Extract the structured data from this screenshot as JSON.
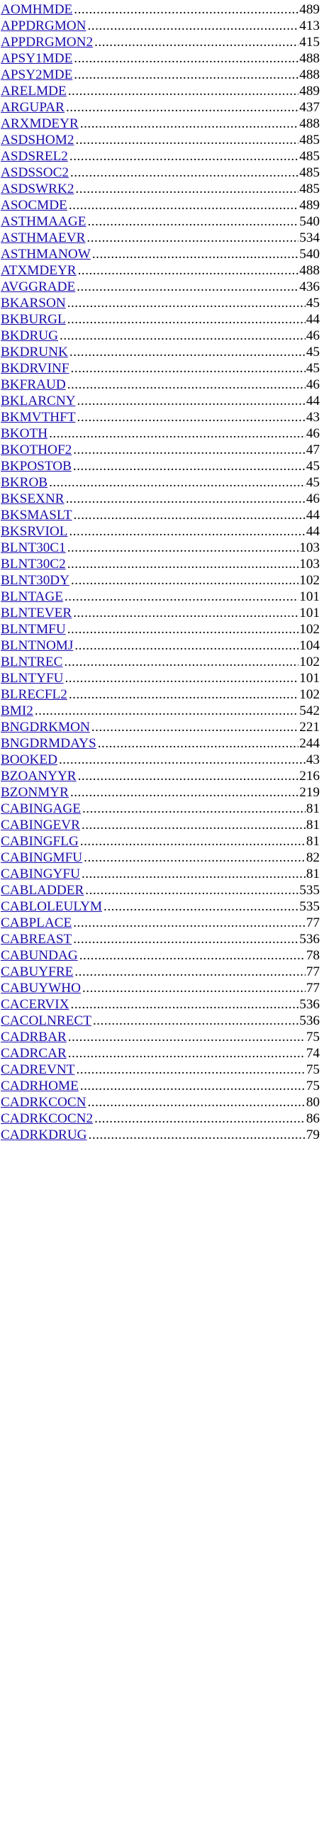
{
  "entries": [
    {
      "term": "AOMHMDE",
      "page": "489"
    },
    {
      "term": "APPDRGMON",
      "page": "413"
    },
    {
      "term": "APPDRGMON2",
      "page": "415"
    },
    {
      "term": "APSY1MDE",
      "page": "488"
    },
    {
      "term": "APSY2MDE",
      "page": "488"
    },
    {
      "term": "ARELMDE",
      "page": "489"
    },
    {
      "term": "ARGUPAR",
      "page": "437"
    },
    {
      "term": "ARXMDEYR",
      "page": "488"
    },
    {
      "term": "ASDSHOM2",
      "page": "485"
    },
    {
      "term": "ASDSREL2",
      "page": "485"
    },
    {
      "term": "ASDSSOC2",
      "page": "485"
    },
    {
      "term": "ASDSWRK2",
      "page": "485"
    },
    {
      "term": "ASOCMDE",
      "page": "489"
    },
    {
      "term": "ASTHMAAGE",
      "page": "540"
    },
    {
      "term": "ASTHMAEVR",
      "page": "534"
    },
    {
      "term": "ASTHMANOW",
      "page": "540"
    },
    {
      "term": "ATXMDEYR",
      "page": "488"
    },
    {
      "term": "AVGGRADE",
      "page": "436"
    },
    {
      "term": "BKARSON",
      "page": "45"
    },
    {
      "term": "BKBURGL",
      "page": "44"
    },
    {
      "term": "BKDRUG",
      "page": "46"
    },
    {
      "term": "BKDRUNK",
      "page": "45"
    },
    {
      "term": "BKDRVINF",
      "page": "45"
    },
    {
      "term": "BKFRAUD",
      "page": "46"
    },
    {
      "term": "BKLARCNY",
      "page": "44"
    },
    {
      "term": "BKMVTHFT",
      "page": "43"
    },
    {
      "term": "BKOTH",
      "page": "46"
    },
    {
      "term": "BKOTHOF2",
      "page": "47"
    },
    {
      "term": "BKPOSTOB",
      "page": "45"
    },
    {
      "term": "BKROB",
      "page": "45"
    },
    {
      "term": "BKSEXNR",
      "page": "46"
    },
    {
      "term": "BKSMASLT",
      "page": "44"
    },
    {
      "term": "BKSRVIOL",
      "page": "44"
    },
    {
      "term": "BLNT30C1",
      "page": "103"
    },
    {
      "term": "BLNT30C2",
      "page": "103"
    },
    {
      "term": "BLNT30DY",
      "page": "102"
    },
    {
      "term": "BLNTAGE",
      "page": "101"
    },
    {
      "term": "BLNTEVER",
      "page": "101"
    },
    {
      "term": "BLNTMFU",
      "page": "102"
    },
    {
      "term": "BLNTNOMJ",
      "page": "104"
    },
    {
      "term": "BLNTREC",
      "page": "102"
    },
    {
      "term": "BLNTYFU",
      "page": "101"
    },
    {
      "term": "BLRECFL2",
      "page": "102"
    },
    {
      "term": "BMI2",
      "page": "542"
    },
    {
      "term": "BNGDRKMON",
      "page": "221"
    },
    {
      "term": "BNGDRMDAYS",
      "page": "244"
    },
    {
      "term": "BOOKED",
      "page": "43"
    },
    {
      "term": "BZOANYYR",
      "page": "216"
    },
    {
      "term": "BZONMYR",
      "page": "219"
    },
    {
      "term": "CABINGAGE",
      "page": "81"
    },
    {
      "term": "CABINGEVR",
      "page": "81"
    },
    {
      "term": "CABINGFLG",
      "page": "81"
    },
    {
      "term": "CABINGMFU",
      "page": "82"
    },
    {
      "term": "CABINGYFU",
      "page": "81"
    },
    {
      "term": "CABLADDER",
      "page": "535"
    },
    {
      "term": "CABLOLEULYM",
      "page": "535"
    },
    {
      "term": "CABPLACE",
      "page": "77"
    },
    {
      "term": "CABREAST",
      "page": "536"
    },
    {
      "term": "CABUNDAG",
      "page": "78"
    },
    {
      "term": "CABUYFRE",
      "page": "77"
    },
    {
      "term": "CABUYWHO",
      "page": "77"
    },
    {
      "term": "CACERVIX",
      "page": "536"
    },
    {
      "term": "CACOLNRECT",
      "page": "536"
    },
    {
      "term": "CADRBAR",
      "page": "75"
    },
    {
      "term": "CADRCAR",
      "page": "74"
    },
    {
      "term": "CADREVNT",
      "page": "75"
    },
    {
      "term": "CADRHOME",
      "page": "75"
    },
    {
      "term": "CADRKCOCN",
      "page": "80"
    },
    {
      "term": "CADRKCOCN2",
      "page": "86"
    },
    {
      "term": "CADRKDRUG",
      "page": "79"
    }
  ]
}
